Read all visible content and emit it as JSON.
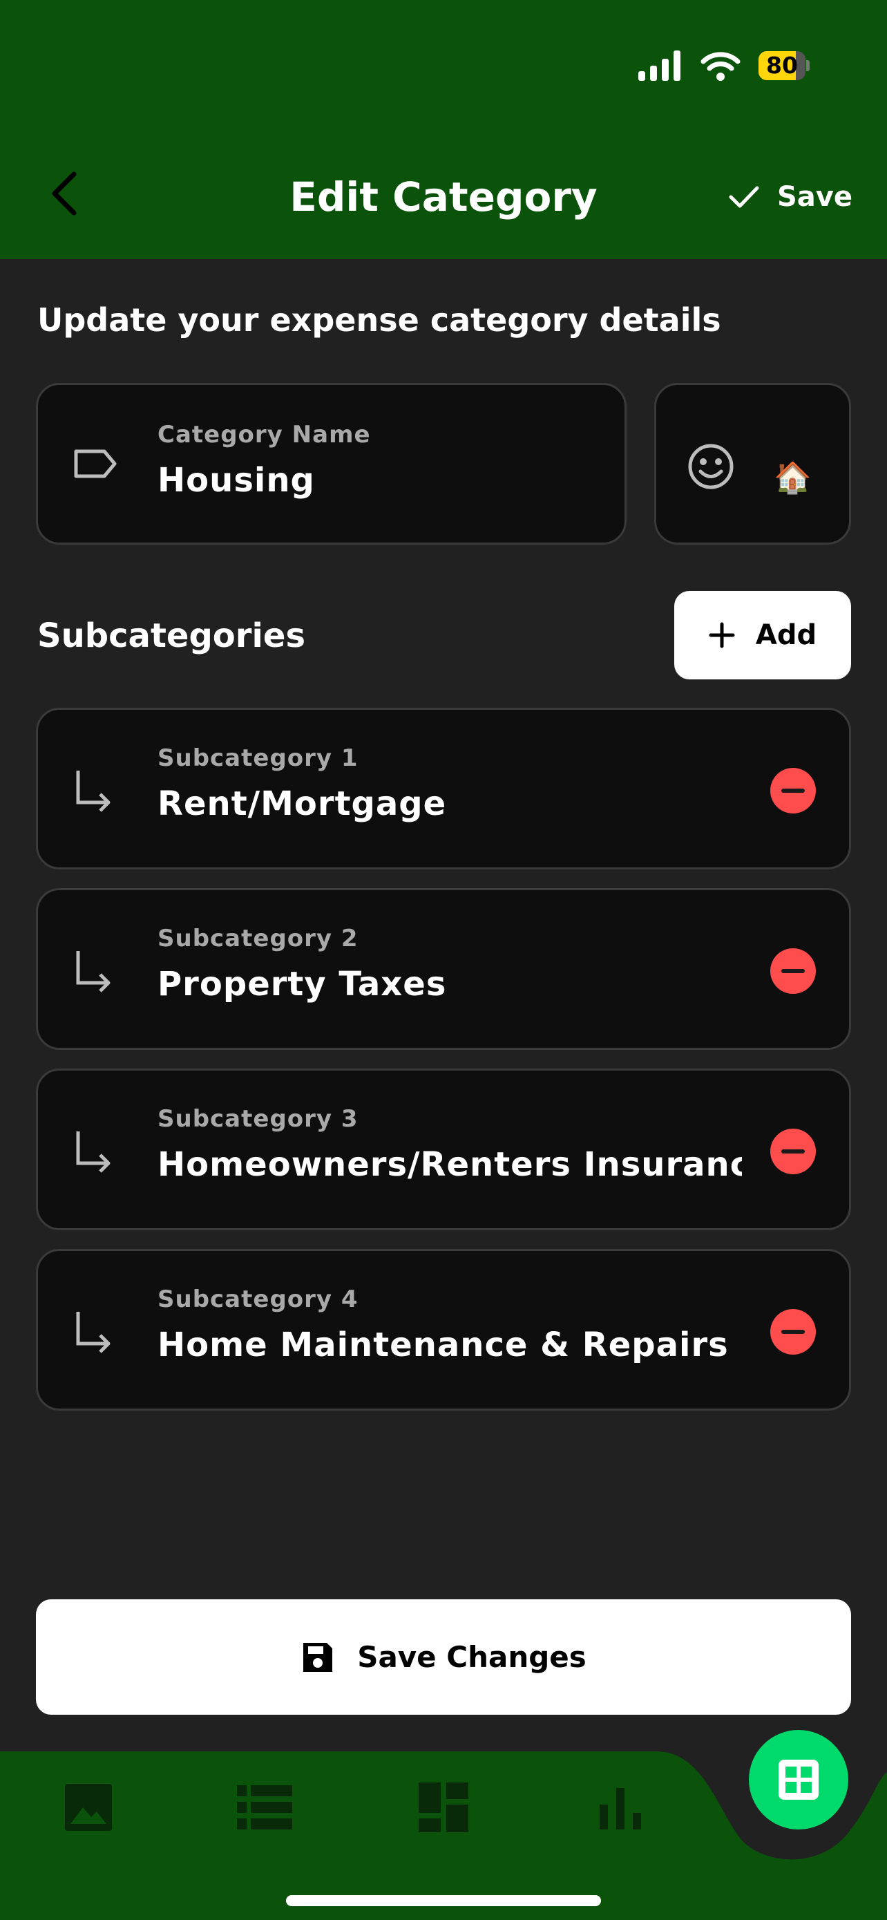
{
  "status": {
    "battery": "80",
    "battery_level": 0.8
  },
  "nav": {
    "title": "Edit Category",
    "save_label": "Save"
  },
  "intro": "Update your expense category details",
  "category": {
    "label": "Category Name",
    "value": "Housing",
    "emoji": "🏠"
  },
  "subcategories": {
    "title": "Subcategories",
    "add_label": "Add",
    "items": [
      {
        "label": "Subcategory 1",
        "value": "Rent/Mortgage"
      },
      {
        "label": "Subcategory 2",
        "value": "Property Taxes"
      },
      {
        "label": "Subcategory 3",
        "value": "Homeowners/Renters Insurance"
      },
      {
        "label": "Subcategory 4",
        "value": "Home Maintenance & Repairs"
      }
    ]
  },
  "save_changes_label": "Save Changes",
  "colors": {
    "header": "#0b520b",
    "accent": "#00d96b",
    "danger": "#ff4d4d",
    "background": "#212121"
  },
  "icons": [
    "back-chevron-icon",
    "check-icon",
    "tag-icon",
    "smiley-icon",
    "subdirectory-arrow-icon",
    "remove-icon",
    "plus-icon",
    "floppy-disk-icon",
    "image-icon",
    "list-icon",
    "dashboard-icon",
    "bar-chart-icon",
    "grid-icon"
  ]
}
